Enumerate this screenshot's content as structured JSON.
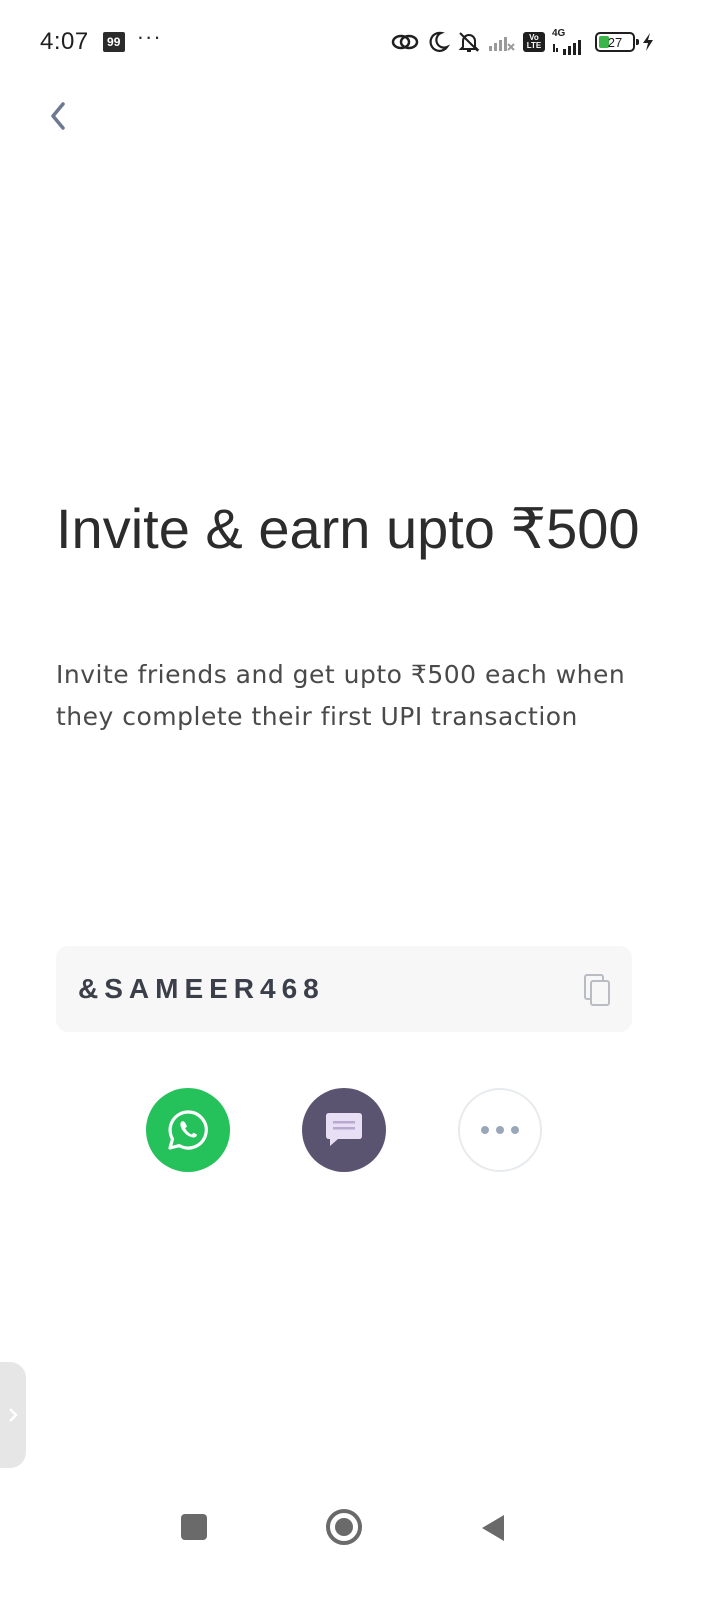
{
  "status_bar": {
    "time": "4:07",
    "notification_badge": "99",
    "more_dots": "···",
    "network_type": "4G",
    "volte_top": "Vo",
    "volte_bottom": "LTE",
    "battery_level": "27",
    "icons": [
      "link-icon",
      "moon-icon",
      "bell-off-icon",
      "signal-x-icon",
      "volte-icon",
      "signal-4g-icon",
      "battery-icon",
      "charging-icon"
    ]
  },
  "header": {
    "back_icon": "chevron-left-icon"
  },
  "main": {
    "title": "Invite & earn upto ₹500",
    "subtitle": "Invite friends and get upto ₹500 each when they complete their first UPI transaction",
    "referral_code": "&SAMEER468",
    "copy_icon": "copy-icon"
  },
  "share": {
    "buttons": [
      {
        "id": "whatsapp",
        "icon": "whatsapp-icon",
        "color": "#25c25c"
      },
      {
        "id": "sms",
        "icon": "message-icon",
        "color": "#5a5470"
      },
      {
        "id": "more",
        "icon": "more-horizontal-icon",
        "color": "#ffffff"
      }
    ]
  },
  "colors": {
    "title": "#2c2c2c",
    "subtitle": "#4a4a4a",
    "code_box_bg": "#f7f7f8",
    "back_icon": "#6b7a90"
  }
}
